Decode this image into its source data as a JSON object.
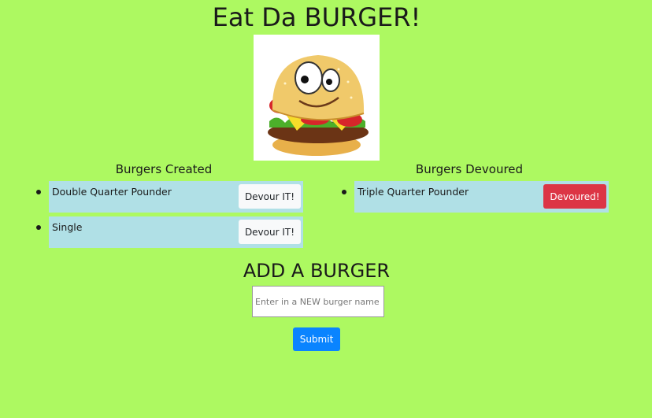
{
  "header": {
    "title": "Eat Da BURGER!"
  },
  "logo": {
    "icon": "cartoon-burger-icon"
  },
  "created": {
    "heading": "Burgers Created",
    "items": [
      {
        "name": "Double Quarter Pounder",
        "button_label": "Devour IT!"
      },
      {
        "name": "Single",
        "button_label": "Devour IT!"
      }
    ]
  },
  "devoured": {
    "heading": "Burgers Devoured",
    "items": [
      {
        "name": "Triple Quarter Pounder",
        "button_label": "Devoured!"
      }
    ]
  },
  "add_form": {
    "heading": "ADD A BURGER",
    "input_placeholder": "Enter in a NEW burger name",
    "input_value": "",
    "submit_label": "Submit"
  },
  "colors": {
    "background": "#adf961",
    "list_item_bg": "#b0e0e6",
    "devour_button": "#f8f9fa",
    "devoured_button": "#dc3545",
    "submit_button": "#0a84ff"
  }
}
